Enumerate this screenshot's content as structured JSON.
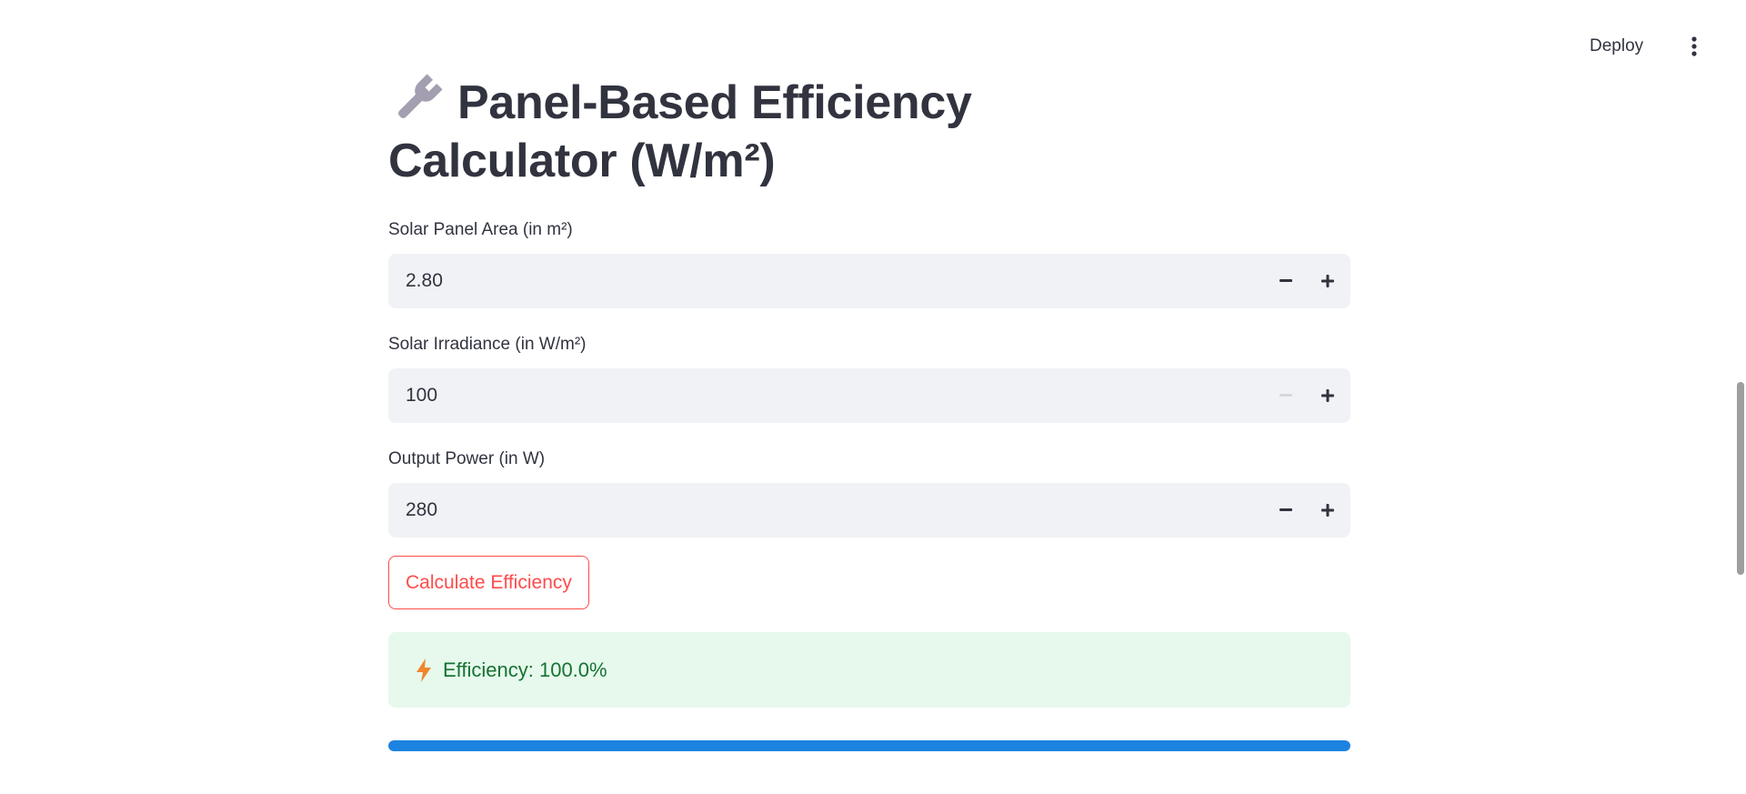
{
  "header": {
    "deploy_label": "Deploy",
    "menu_icon": "vertical-ellipsis-icon"
  },
  "page": {
    "title_icon": "wrench-icon",
    "title": "Panel-Based Efficiency Calculator (W/m²)"
  },
  "fields": [
    {
      "label": "Solar Panel Area (in m²)",
      "value": "2.80",
      "minus_enabled": true,
      "plus_enabled": true
    },
    {
      "label": "Solar Irradiance (in W/m²)",
      "value": "100",
      "minus_enabled": false,
      "plus_enabled": true
    },
    {
      "label": "Output Power (in W)",
      "value": "280",
      "minus_enabled": true,
      "plus_enabled": true
    }
  ],
  "calculate_button": {
    "label": "Calculate Efficiency"
  },
  "result": {
    "icon": "lightning-bolt-icon",
    "text": "Efficiency: 100.0%"
  },
  "progress": {
    "value": 1.0
  },
  "colors": {
    "primary": "#ff4b4b",
    "success_bg": "#e6f9ec",
    "success_text": "#177233",
    "progress": "#1c83e1",
    "input_bg": "#f0f2f6",
    "bolt": "#f0852d"
  }
}
